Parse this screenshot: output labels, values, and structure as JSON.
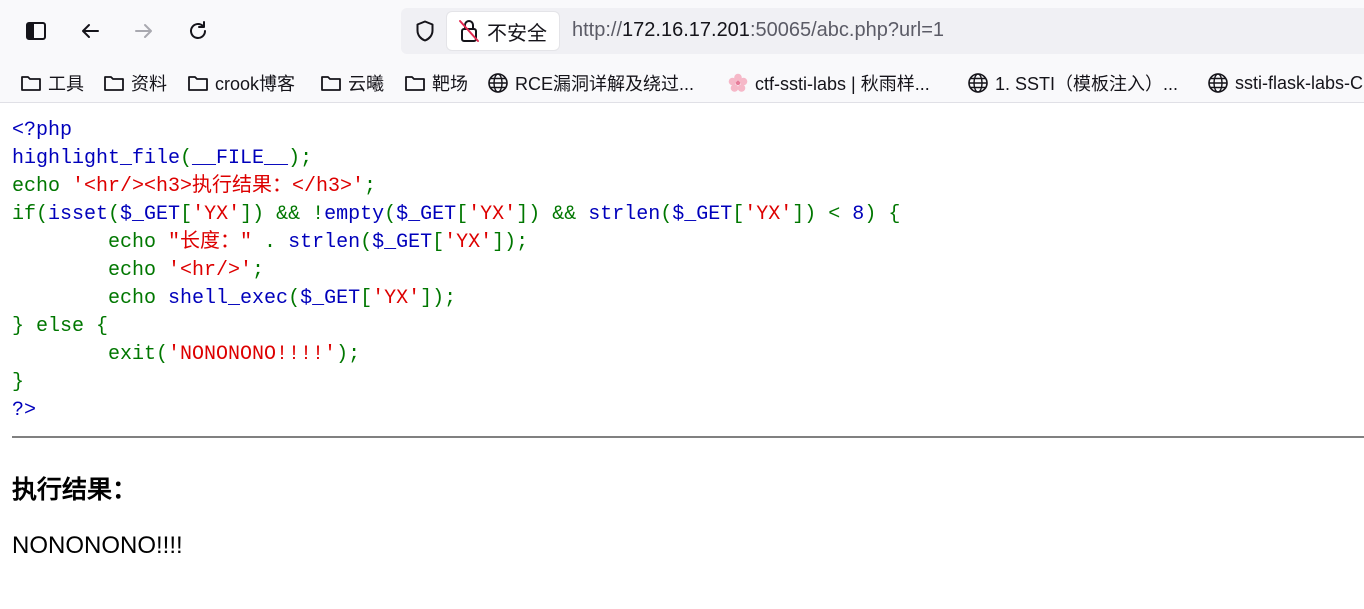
{
  "browser": {
    "security_label": "不安全",
    "url_prefix": "http://",
    "url_host": "172.16.17.201",
    "url_rest": ":50065/abc.php?url=1"
  },
  "bookmarks": [
    {
      "label": "工具",
      "icon": "folder-icon"
    },
    {
      "label": "资料",
      "icon": "folder-icon"
    },
    {
      "label": "crook博客",
      "icon": "folder-icon"
    },
    {
      "label": "云曦",
      "icon": "folder-icon"
    },
    {
      "label": "靶场",
      "icon": "folder-icon"
    },
    {
      "label": "RCE漏洞详解及绕过...",
      "icon": "globe-icon"
    },
    {
      "label": "ctf-ssti-labs | 秋雨样...",
      "icon": "flower-icon"
    },
    {
      "label": "1. SSTI（模板注入）...",
      "icon": "globe-icon"
    },
    {
      "label": "ssti-flask-labs-C",
      "icon": "globe-icon"
    }
  ],
  "code": {
    "l1": "<?php",
    "l2a": "highlight_file",
    "l2b": "(",
    "l2c": "__FILE__",
    "l2d": ");",
    "l3a": "echo ",
    "l3b": "'<hr/><h3>执行结果：</h3>'",
    "l3c": ";",
    "l4a": "if(",
    "l4b": "isset",
    "l4c": "(",
    "l4d": "$_GET",
    "l4e": "[",
    "l4f": "'YX'",
    "l4g": "]) && !",
    "l4h": "empty",
    "l4i": "(",
    "l4j": "$_GET",
    "l4k": "[",
    "l4l": "'YX'",
    "l4m": "]) && ",
    "l4n": "strlen",
    "l4o": "(",
    "l4p": "$_GET",
    "l4q": "[",
    "l4r": "'YX'",
    "l4s": "]) < ",
    "l4t": "8",
    "l4u": ") {",
    "l5a": "        echo ",
    "l5b": "\"长度：\"",
    "l5c": " . ",
    "l5d": "strlen",
    "l5e": "(",
    "l5f": "$_GET",
    "l5g": "[",
    "l5h": "'YX'",
    "l5i": "]);",
    "l6a": "        echo ",
    "l6b": "'<hr/>'",
    "l6c": ";",
    "l7a": "        echo ",
    "l7b": "shell_exec",
    "l7c": "(",
    "l7d": "$_GET",
    "l7e": "[",
    "l7f": "'YX'",
    "l7g": "]);",
    "l8": "} else {",
    "l9a": "        exit(",
    "l9b": "'NONONONO!!!!'",
    "l9c": ");",
    "l10": "}",
    "l11": "?>"
  },
  "result_heading": "执行结果：",
  "result_text": "NONONONO!!!!",
  "colors": {
    "keyword": "#007700",
    "default": "#0000BB",
    "string": "#DD0000"
  }
}
